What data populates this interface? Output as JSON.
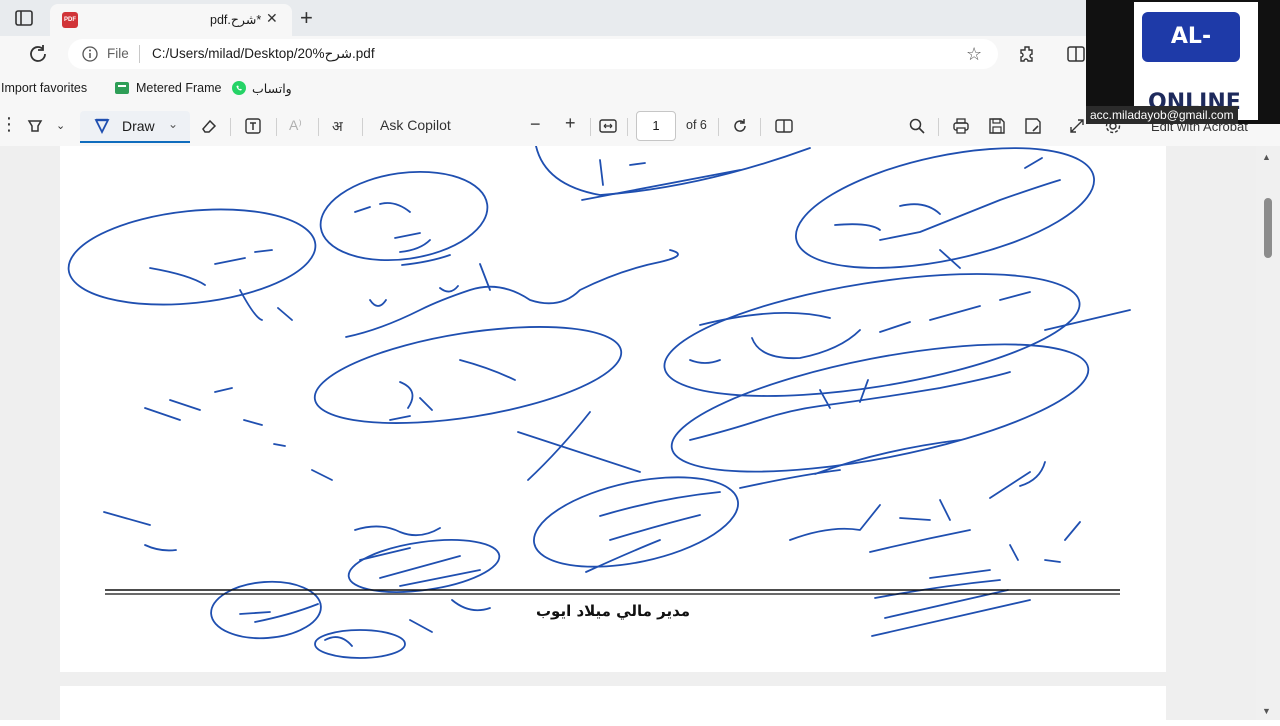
{
  "tab": {
    "title": "pdf.شرح*"
  },
  "address": {
    "file_label": "File",
    "url": "C:/Users/milad/Desktop/20%شرح.pdf"
  },
  "favorites": [
    {
      "label": "Import favorites"
    },
    {
      "label": "Metered Frame"
    },
    {
      "label": "واتساب"
    }
  ],
  "pdf_toolbar": {
    "draw_label": "Draw",
    "ask_copilot": "Ask Copilot",
    "page_current": "1",
    "page_total": "of 6",
    "edit_acrobat": "Edit with Acrobat"
  },
  "document": {
    "signature": "مدير مالي ميلاد ايوب"
  },
  "overlay": {
    "logo_text": "AL-MeeD",
    "logo_sub": "ONLINE",
    "email": "acc.miladayob@gmail.com"
  },
  "colors": {
    "ink": "#1f4fb0",
    "accent": "#0f6cbd",
    "tab_bg": "#e8ebee",
    "chrome_bg": "#f7f7f7"
  }
}
